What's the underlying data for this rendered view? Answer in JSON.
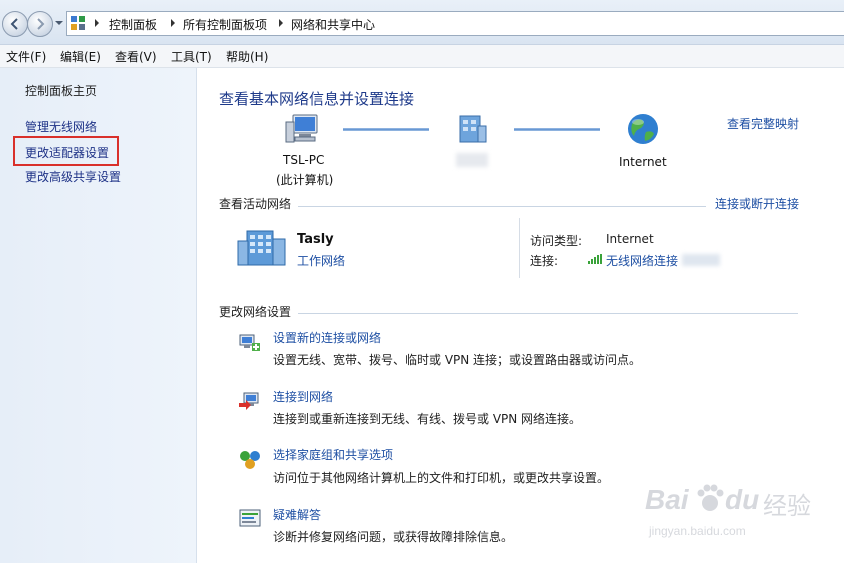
{
  "breadcrumb": {
    "items": [
      "控制面板",
      "所有控制面板项",
      "网络和共享中心"
    ]
  },
  "menu": {
    "items": [
      "文件(F)",
      "编辑(E)",
      "查看(V)",
      "工具(T)",
      "帮助(H)"
    ]
  },
  "sidebar": {
    "home": "控制面板主页",
    "links": [
      "管理无线网络",
      "更改适配器设置",
      "更改高级共享设置"
    ],
    "highlighted": "更改适配器设置"
  },
  "main": {
    "title": "查看基本网络信息并设置连接",
    "full_map_link": "查看完整映射",
    "map": {
      "computer_name": "TSL-PC",
      "computer_sub": "(此计算机)",
      "internet_label": "Internet"
    },
    "active": {
      "section_title": "查看活动网络",
      "connect_link": "连接或断开连接",
      "network_name": "Tasly",
      "network_type": "工作网络",
      "access_label": "访问类型:",
      "access_value": "Internet",
      "conn_label": "连接:",
      "conn_value": "无线网络连接"
    },
    "change": {
      "section_title": "更改网络设置",
      "tasks": [
        {
          "title": "设置新的连接或网络",
          "desc": "设置无线、宽带、拨号、临时或 VPN 连接；或设置路由器或访问点。",
          "icon": "new-connection-icon"
        },
        {
          "title": "连接到网络",
          "desc": "连接到或重新连接到无线、有线、拨号或 VPN 网络连接。",
          "icon": "connect-network-icon"
        },
        {
          "title": "选择家庭组和共享选项",
          "desc": "访问位于其他网络计算机上的文件和打印机，或更改共享设置。",
          "icon": "homegroup-icon"
        },
        {
          "title": "疑难解答",
          "desc": "诊断并修复网络问题，或获得故障排除信息。",
          "icon": "troubleshoot-icon"
        }
      ]
    }
  },
  "watermark": {
    "brand": "Bai",
    "brand2": "du",
    "cn": "经验",
    "url": "jingyan.baidu.com"
  },
  "colors": {
    "link": "#1e4fa3",
    "title": "#1e3a8a",
    "highlight": "#d9302b"
  }
}
